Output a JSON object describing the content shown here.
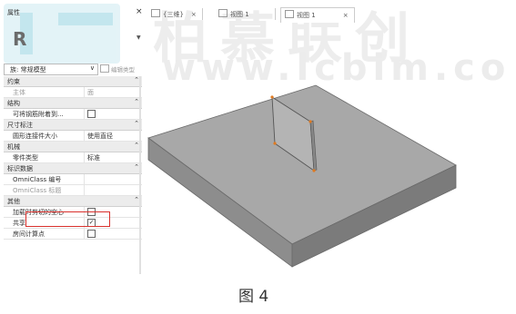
{
  "watermark": {
    "logo_letter": "R",
    "brand_cn": "柏慕联创",
    "url": "www.lcbim.co"
  },
  "panel": {
    "title": "属性",
    "close": "×",
    "type_select": "族: 常规模型",
    "edit_type": "编辑类型",
    "sections": [
      {
        "label": "约束",
        "props": [
          {
            "key": "主体",
            "value": "面",
            "dim": true
          }
        ]
      },
      {
        "label": "结构",
        "props": [
          {
            "key": "可将钢筋附着到...",
            "checkbox": false
          }
        ]
      },
      {
        "label": "尺寸标注",
        "props": [
          {
            "key": "圆形连接件大小",
            "value": "使用直径"
          }
        ]
      },
      {
        "label": "机械",
        "props": [
          {
            "key": "零件类型",
            "value": "标准"
          }
        ]
      },
      {
        "label": "标识数据",
        "props": [
          {
            "key": "OmniClass 编号",
            "value": "",
            "dim": false
          },
          {
            "key": "OmniClass 标题",
            "value": "",
            "dim": true
          }
        ]
      },
      {
        "label": "其他",
        "props": [
          {
            "key": "加载时剪切的空心",
            "checkbox": false
          },
          {
            "key": "共享",
            "checkbox": true
          },
          {
            "key": "房间计算点",
            "checkbox": false
          }
        ]
      }
    ]
  },
  "tabs": [
    {
      "label": "{三维}",
      "close": "×"
    },
    {
      "label": "视图 1",
      "close": ""
    },
    {
      "label": "视图 1",
      "close": "×",
      "active": true
    }
  ],
  "caption": "图 4",
  "colors": {
    "highlight": "#d9302c",
    "slab_top": "#a8a8a8",
    "slab_front": "#8b8b8b",
    "slab_side": "#7a7a7a"
  }
}
